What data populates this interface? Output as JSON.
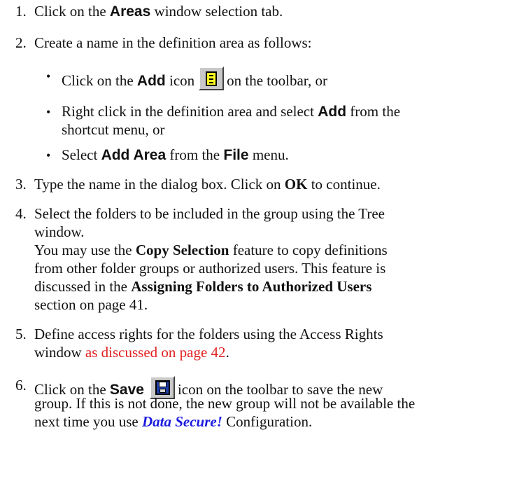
{
  "steps": [
    {
      "number": "1.",
      "pre": "Click on  the ",
      "bold": "Areas",
      "post": " window selection tab."
    },
    {
      "number": "2.",
      "text": "Create a name in the definition area as follows:",
      "bullets": [
        {
          "pre": "Click on the ",
          "bold": "Add",
          "mid": " icon",
          "icon": "add-icon",
          "post": "on the toolbar, or"
        },
        {
          "line1_pre": "Right click in the definition area and select ",
          "line1_bold": "Add",
          "line1_post": " from the",
          "line2": "shortcut menu, or"
        },
        {
          "pre": "Select ",
          "bold1": "Add Area",
          "mid": " from the ",
          "bold2": "File",
          "post": " menu."
        }
      ]
    },
    {
      "number": "3.",
      "pre": "Type the name in the dialog box.  Click on ",
      "bold": "OK",
      "post": " to continue."
    },
    {
      "number": "4.",
      "line1": "Select the folders to be included in the group using the Tree",
      "line2": "window.",
      "line3_pre": "You may use the ",
      "line3_bold": "Copy Selection",
      "line3_post": " feature to copy definitions",
      "line4": "from other folder groups or authorized users.  This feature is",
      "line5_pre": "discussed in the ",
      "line5_bold": "Assigning Folders to Authorized Users",
      "line6": "section on page 41."
    },
    {
      "number": "5.",
      "line1": "Define access rights for the folders using the Access Rights",
      "line2_pre": "window ",
      "line2_link": "as discussed on page 42",
      "line2_post": "."
    },
    {
      "number": "6.",
      "line1_pre": "Click on the ",
      "line1_bold": "Save",
      "line1_icon": "save-icon",
      "line1_post": "icon on the toolbar to save the new",
      "line2": "group. If this is not done, the new group will not be available the",
      "line3_pre": "next time you use ",
      "line3_brand": "Data Secure!",
      "line3_post": " Configuration."
    }
  ],
  "bullet_glyph": "•",
  "colors": {
    "link": "#e02020",
    "brand": "#1a1adf",
    "icon_face": "#c8c8c8"
  }
}
